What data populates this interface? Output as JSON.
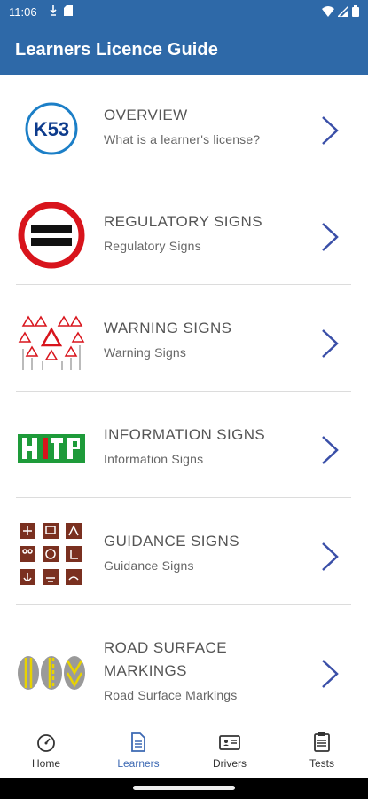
{
  "status_bar": {
    "time": "11:06",
    "icons": [
      "download-icon",
      "sd-card-icon",
      "wifi-icon",
      "signal-icon",
      "battery-icon"
    ]
  },
  "app_bar": {
    "title": "Learners Licence Guide"
  },
  "items": [
    {
      "title": "OVERVIEW",
      "subtitle": "What is a learner's license?",
      "thumb": "k53-logo",
      "thumb_text": "K53"
    },
    {
      "title": "REGULATORY SIGNS",
      "subtitle": "Regulatory Signs",
      "thumb": "regulatory-sign"
    },
    {
      "title": "WARNING SIGNS",
      "subtitle": "Warning Signs",
      "thumb": "warning-signs"
    },
    {
      "title": "INFORMATION SIGNS",
      "subtitle": "Information Signs",
      "thumb": "information-signs"
    },
    {
      "title": "GUIDANCE SIGNS",
      "subtitle": "Guidance Signs",
      "thumb": "guidance-signs"
    },
    {
      "title_line1": "ROAD SURFACE",
      "title_line2": "MARKINGS",
      "subtitle": "Road Surface Markings",
      "thumb": "road-surface-markings"
    }
  ],
  "bottom_nav": [
    {
      "label": "Home",
      "icon": "speedometer-icon",
      "active": false
    },
    {
      "label": "Learners",
      "icon": "document-icon",
      "active": true
    },
    {
      "label": "Drivers",
      "icon": "license-card-icon",
      "active": false
    },
    {
      "label": "Tests",
      "icon": "clipboard-icon",
      "active": false
    }
  ],
  "colors": {
    "app_bar": "#2e69a8",
    "chevron": "#3a4fa8",
    "active_nav": "#3d69b3",
    "regulatory_red": "#d8141c",
    "info_green": "#1e9b3a",
    "guidance_brown": "#7a3020"
  }
}
